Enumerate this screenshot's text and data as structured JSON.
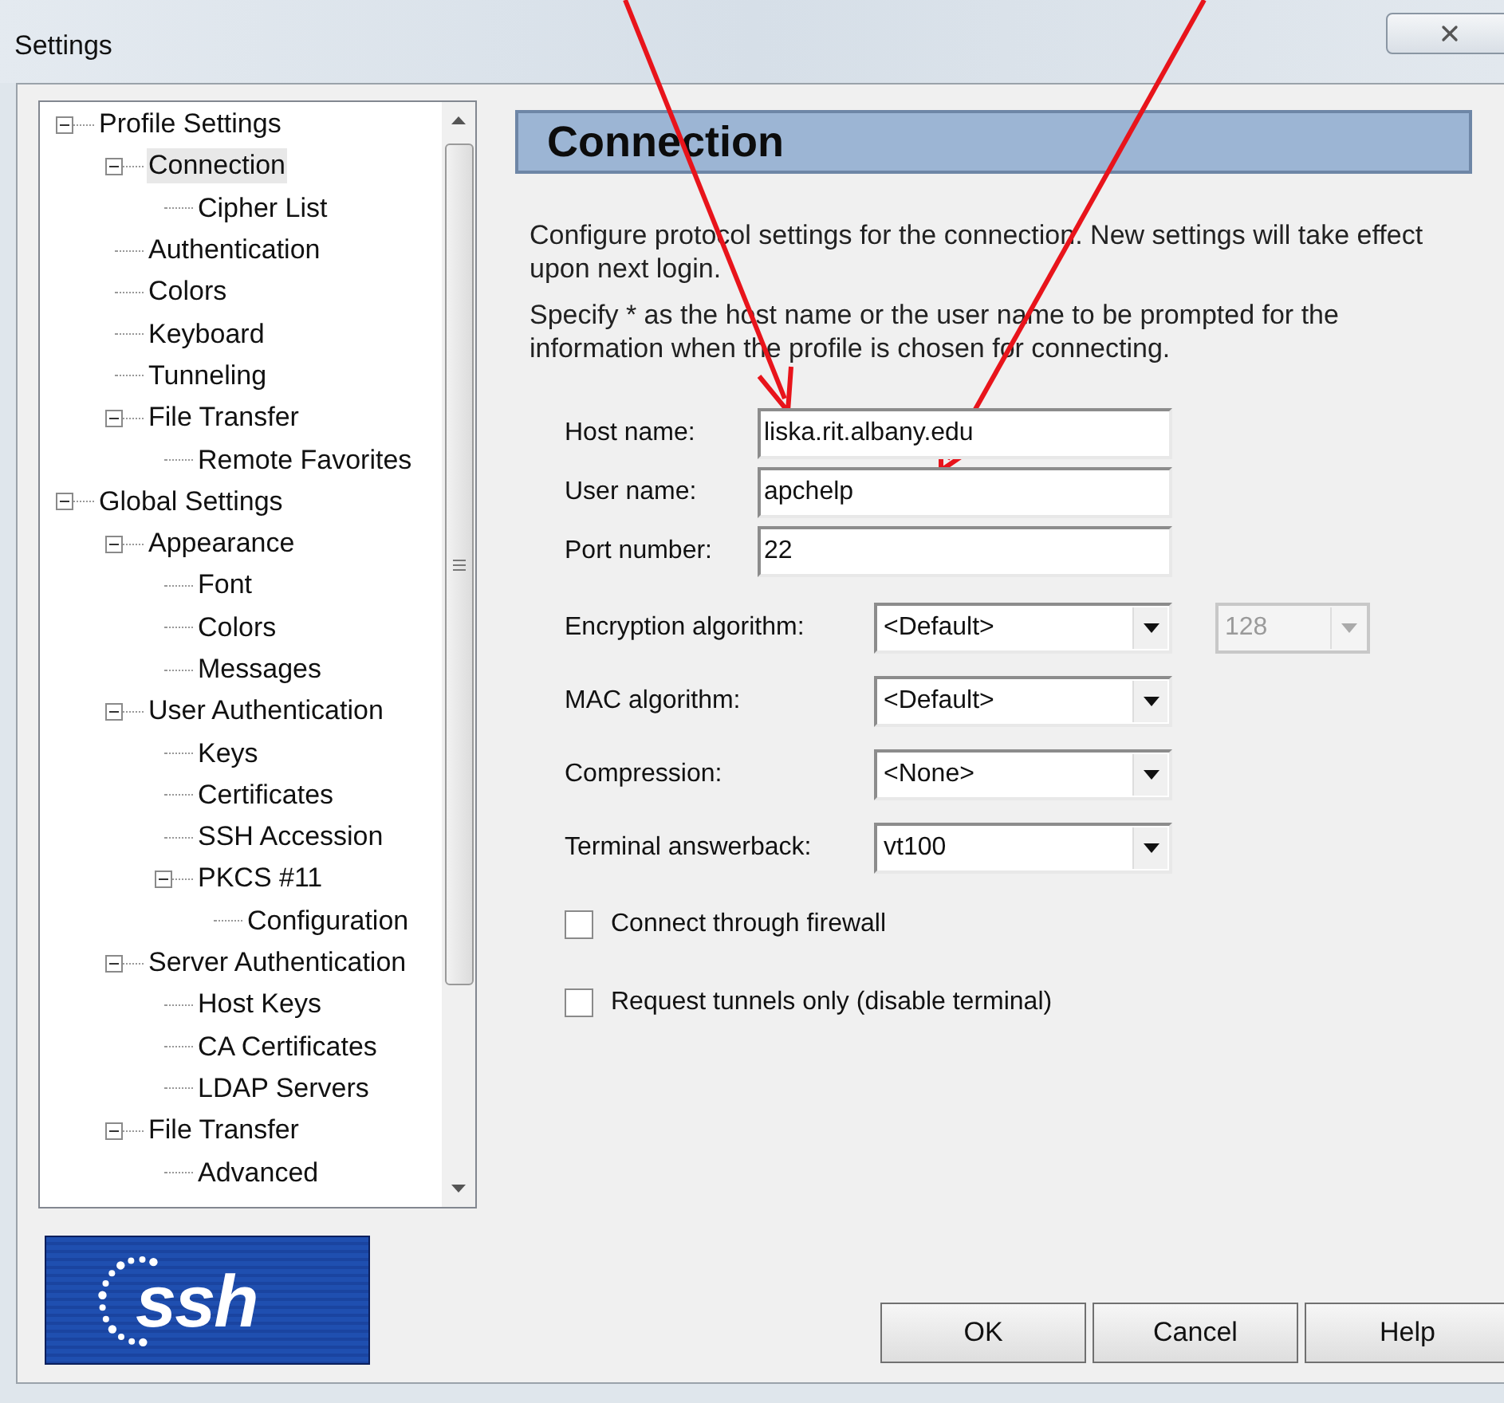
{
  "window": {
    "title": "Settings"
  },
  "tree": [
    {
      "label": "Profile Settings",
      "expanded": true,
      "selected": false,
      "children": [
        {
          "label": "Connection",
          "expanded": true,
          "selected": true,
          "children": [
            {
              "label": "Cipher List",
              "selected": false
            }
          ]
        },
        {
          "label": "Authentication",
          "selected": false
        },
        {
          "label": "Colors",
          "selected": false
        },
        {
          "label": "Keyboard",
          "selected": false
        },
        {
          "label": "Tunneling",
          "selected": false
        },
        {
          "label": "File Transfer",
          "expanded": true,
          "selected": false,
          "children": [
            {
              "label": "Remote Favorites",
              "selected": false
            }
          ]
        }
      ]
    },
    {
      "label": "Global Settings",
      "expanded": true,
      "selected": false,
      "children": [
        {
          "label": "Appearance",
          "expanded": true,
          "selected": false,
          "children": [
            {
              "label": "Font",
              "selected": false
            },
            {
              "label": "Colors",
              "selected": false
            },
            {
              "label": "Messages",
              "selected": false
            }
          ]
        },
        {
          "label": "User Authentication",
          "expanded": true,
          "selected": false,
          "children": [
            {
              "label": "Keys",
              "selected": false
            },
            {
              "label": "Certificates",
              "selected": false
            },
            {
              "label": "SSH Accession",
              "selected": false
            },
            {
              "label": "PKCS #11",
              "expanded": true,
              "selected": false,
              "children": [
                {
                  "label": "Configuration",
                  "selected": false
                }
              ]
            }
          ]
        },
        {
          "label": "Server Authentication",
          "expanded": true,
          "selected": false,
          "children": [
            {
              "label": "Host Keys",
              "selected": false
            },
            {
              "label": "CA Certificates",
              "selected": false
            },
            {
              "label": "LDAP Servers",
              "selected": false
            }
          ]
        },
        {
          "label": "File Transfer",
          "expanded": true,
          "selected": false,
          "children": [
            {
              "label": "Advanced",
              "selected": false
            }
          ]
        }
      ]
    }
  ],
  "logo": {
    "text": "ssh"
  },
  "panel": {
    "title": "Connection",
    "paragraphs": [
      "Configure protocol settings for the connection. New settings will take effect upon next login.",
      "Specify * as the host name or the user name to be prompted for the information when the profile is chosen for connecting."
    ],
    "fields": [
      {
        "kind": "text",
        "label": "Host name:",
        "value": "liska.rit.albany.edu"
      },
      {
        "kind": "text",
        "label": "User name:",
        "value": "apchelp"
      },
      {
        "kind": "text",
        "label": "Port number:",
        "value": "22"
      },
      {
        "kind": "select",
        "label": "Encryption algorithm:",
        "value": "<Default>",
        "extra": {
          "value": "128",
          "disabled": true
        }
      },
      {
        "kind": "select",
        "label": "MAC algorithm:",
        "value": "<Default>"
      },
      {
        "kind": "select",
        "label": "Compression:",
        "value": "<None>"
      },
      {
        "kind": "select",
        "label": "Terminal answerback:",
        "value": "vt100"
      }
    ],
    "checkboxes": [
      {
        "label": "Connect through firewall",
        "checked": false
      },
      {
        "label": "Request tunnels only (disable terminal)",
        "checked": false
      }
    ]
  },
  "buttons": [
    "OK",
    "Cancel",
    "Help"
  ]
}
